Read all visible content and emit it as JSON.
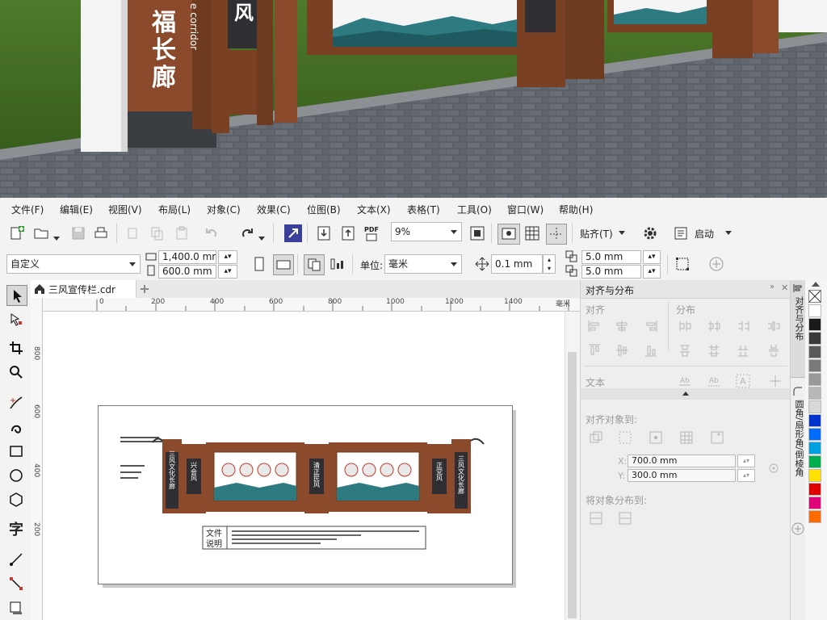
{
  "photo": {
    "sign_chars": [
      "福",
      "长",
      "廊"
    ],
    "sign_latin": "e corridor",
    "panel_char": "风"
  },
  "menu": [
    "文件(F)",
    "编辑(E)",
    "视图(V)",
    "布局(L)",
    "对象(C)",
    "效果(C)",
    "位图(B)",
    "文本(X)",
    "表格(T)",
    "工具(O)",
    "窗口(W)",
    "帮助(H)"
  ],
  "toolbar1": {
    "zoom": "9%",
    "snap_label": "贴齐(T)",
    "launch_label": "启动",
    "pdf_label": "PDF"
  },
  "toolbar2": {
    "page_preset": "自定义",
    "width": "1,400.0 mm",
    "height": "600.0 mm",
    "unit_label": "单位:",
    "unit": "毫米",
    "nudge": "0.1 mm",
    "dup_x": "5.0 mm",
    "dup_y": "5.0 mm"
  },
  "document": {
    "tab_name": "三风宣传栏.cdr",
    "ruler_h": [
      "200",
      "400",
      "600",
      "800",
      "1000",
      "1200",
      "1400"
    ],
    "ruler_h_unit": "毫米",
    "ruler_v": [
      "800",
      "600",
      "400",
      "200"
    ],
    "ruler_zero": "0"
  },
  "drawing": {
    "left_post": "三风文化长廊",
    "mid_post_1": "兴会风",
    "mid_post_2": "清正民风",
    "right_post": "三风文化长廊",
    "right_post_small": "正党风",
    "note_label_1": "文件",
    "note_label_2": "说明"
  },
  "docker": {
    "title": "对齐与分布",
    "align_label": "对齐",
    "distribute_label": "分布",
    "text_label": "文本",
    "align_to_label": "对齐对象到:",
    "x_label": "X:",
    "x_value": "700.0 mm",
    "y_label": "Y:",
    "y_value": "300.0 mm",
    "distribute_to_label": "将对象分布到:"
  },
  "side_tabs": [
    "对齐与分布",
    "圆角/扇形角/倒棱角"
  ],
  "palette": [
    "#ffffff",
    "#1a1a1a",
    "#3a3a3a",
    "#595959",
    "#7a7a7a",
    "#999999",
    "#b8b8b8",
    "#d8d8d8",
    "#0033cc",
    "#006dff",
    "#00a0e0",
    "#00b050",
    "#ffe000",
    "#e00000",
    "#e0007a",
    "#ff6a00"
  ]
}
